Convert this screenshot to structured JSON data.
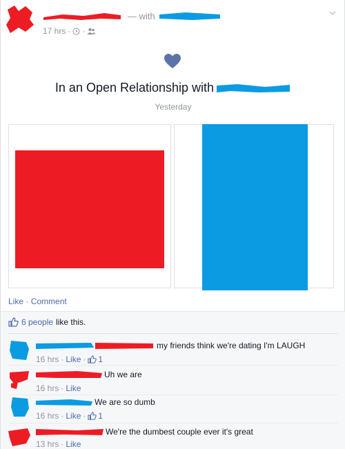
{
  "post": {
    "with_label": "— with",
    "timestamp": "17 hrs",
    "privacy_icon": "friends-icon",
    "event_title": "In an Open Relationship with",
    "event_date": "Yesterday"
  },
  "actions": {
    "like_label": "Like",
    "comment_label": "Comment"
  },
  "likes": {
    "count_label": "6 people",
    "suffix": "like this."
  },
  "comments": [
    {
      "text": "my friends think we're dating I'm LAUGH",
      "time": "16 hrs",
      "like_label": "Like",
      "like_count": "1"
    },
    {
      "text": "Uh we are",
      "time": "16 hrs",
      "like_label": "Like",
      "like_count": ""
    },
    {
      "text": "We are so dumb",
      "time": "16 hrs",
      "like_label": "Like",
      "like_count": "1"
    },
    {
      "text": "We're the dumbest couple ever it's great",
      "time": "13 hrs",
      "like_label": "Like",
      "like_count": ""
    }
  ],
  "colors": {
    "red_redaction": "#ed1c24",
    "blue_redaction": "#0a9be2",
    "link": "#4b6aa9",
    "heart": "#5b74a8"
  }
}
